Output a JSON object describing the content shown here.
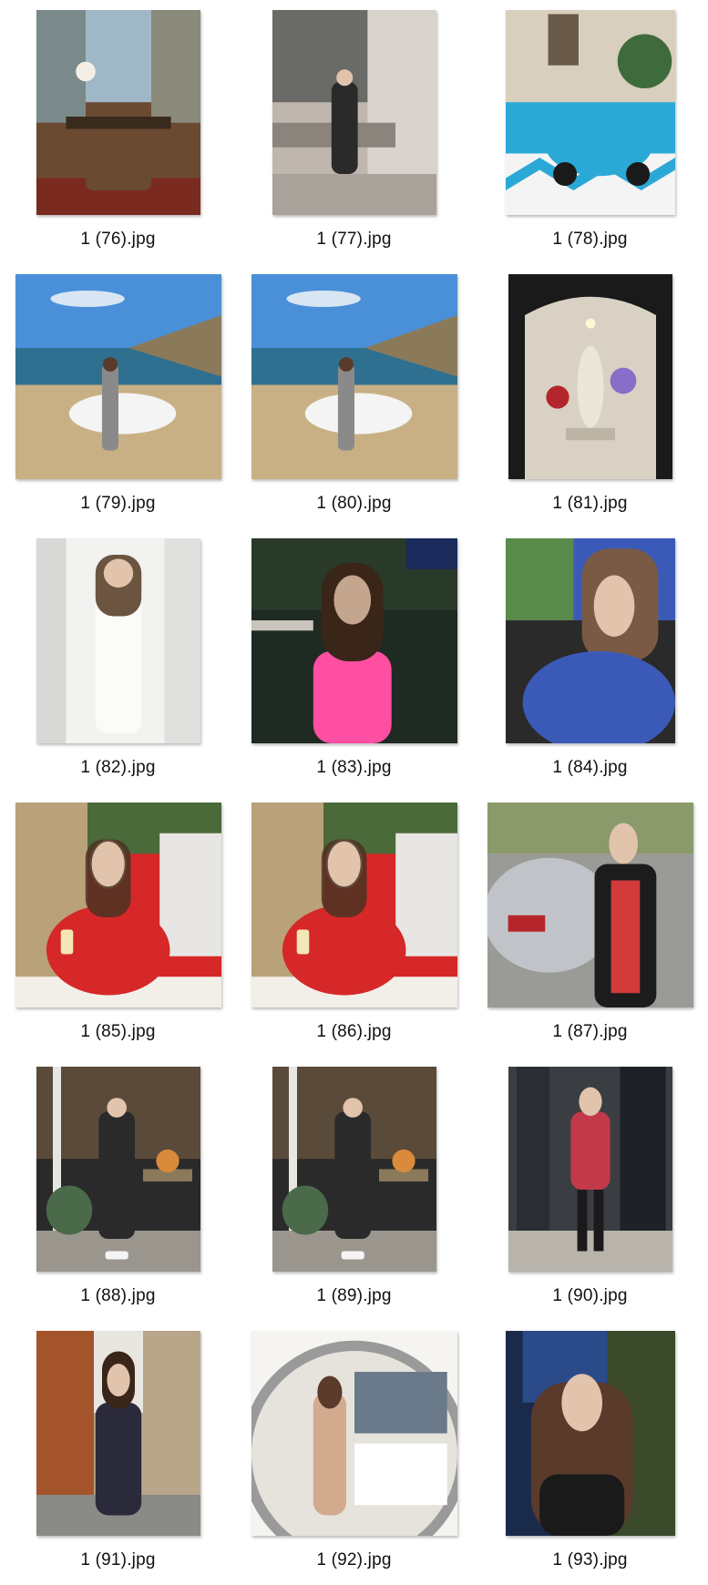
{
  "files": [
    {
      "name": "1 (76).jpg",
      "orientation": "portrait",
      "scene": "dark-interior-paintings",
      "palette": [
        "#6b4a32",
        "#3a2a1e",
        "#9fb7c6",
        "#c9b38e"
      ]
    },
    {
      "name": "1 (77).jpg",
      "orientation": "portrait",
      "scene": "stone-bench-window",
      "palette": [
        "#bfb7ae",
        "#8a847d",
        "#2a2a2a",
        "#d8d3cc"
      ]
    },
    {
      "name": "1 (78).jpg",
      "orientation": "square",
      "scene": "blue-scooter-cafe",
      "palette": [
        "#2aa9d6",
        "#e9e4da",
        "#3f6b3c",
        "#c79a6a"
      ]
    },
    {
      "name": "1 (79).jpg",
      "orientation": "landscape",
      "scene": "coast-white-car",
      "palette": [
        "#4a90d9",
        "#e8eef5",
        "#2f6f8f",
        "#c9b084"
      ]
    },
    {
      "name": "1 (80).jpg",
      "orientation": "landscape",
      "scene": "coast-white-car",
      "palette": [
        "#4a90d9",
        "#e8eef5",
        "#2f6f8f",
        "#c9b084"
      ]
    },
    {
      "name": "1 (81).jpg",
      "orientation": "portrait",
      "scene": "stone-niche-statue",
      "palette": [
        "#1a1a1a",
        "#d9d2c4",
        "#8a6cc9",
        "#b3262b"
      ]
    },
    {
      "name": "1 (82).jpg",
      "orientation": "portrait",
      "scene": "white-outfit-mirror",
      "palette": [
        "#f2f2f0",
        "#cfcfcf",
        "#6b5440",
        "#3a3a3a"
      ]
    },
    {
      "name": "1 (83).jpg",
      "orientation": "landscape",
      "scene": "pink-dress-patio-night",
      "palette": [
        "#1e2a22",
        "#ff4fa3",
        "#c4a58e",
        "#3a4a3c"
      ]
    },
    {
      "name": "1 (84).jpg",
      "orientation": "square",
      "scene": "blue-floral-car",
      "palette": [
        "#3b5ab8",
        "#d9d9d9",
        "#7a5a44",
        "#222222"
      ]
    },
    {
      "name": "1 (85).jpg",
      "orientation": "landscape",
      "scene": "red-shirt-wine-table",
      "palette": [
        "#d62828",
        "#f2efe9",
        "#7a6a4a",
        "#4a6a3a"
      ]
    },
    {
      "name": "1 (86).jpg",
      "orientation": "landscape",
      "scene": "red-shirt-wine-table",
      "palette": [
        "#d62828",
        "#f2efe9",
        "#7a6a4a",
        "#4a6a3a"
      ]
    },
    {
      "name": "1 (87).jpg",
      "orientation": "landscape",
      "scene": "silver-car-black-blazer",
      "palette": [
        "#c0c4c8",
        "#1c1c1c",
        "#d23a3a",
        "#8a9a6a"
      ]
    },
    {
      "name": "1 (88).jpg",
      "orientation": "portrait",
      "scene": "street-black-coat-flowers",
      "palette": [
        "#2a2a2a",
        "#8a7a5a",
        "#d98a3a",
        "#4a6a4a"
      ]
    },
    {
      "name": "1 (89).jpg",
      "orientation": "portrait",
      "scene": "street-black-coat-flowers",
      "palette": [
        "#2a2a2a",
        "#8a7a5a",
        "#d98a3a",
        "#4a6a4a"
      ]
    },
    {
      "name": "1 (90).jpg",
      "orientation": "portrait",
      "scene": "dark-storefront-floral-dress",
      "palette": [
        "#3a3e42",
        "#1a1a1a",
        "#c23a4a",
        "#8a8a8a"
      ]
    },
    {
      "name": "1 (91).jpg",
      "orientation": "portrait",
      "scene": "city-street-floral-dress",
      "palette": [
        "#b9a58a",
        "#2a2a3a",
        "#8a3a2a",
        "#d8d0c4"
      ]
    },
    {
      "name": "1 (92).jpg",
      "orientation": "landscape",
      "scene": "round-mirror-bedroom",
      "palette": [
        "#e6e2dc",
        "#9a9a9a",
        "#4a4a4a",
        "#c9c4bc"
      ]
    },
    {
      "name": "1 (93).jpg",
      "orientation": "square",
      "scene": "night-window-portrait",
      "palette": [
        "#1a2a4a",
        "#5a3a2a",
        "#4a6a3a",
        "#2a2a2a"
      ]
    }
  ]
}
